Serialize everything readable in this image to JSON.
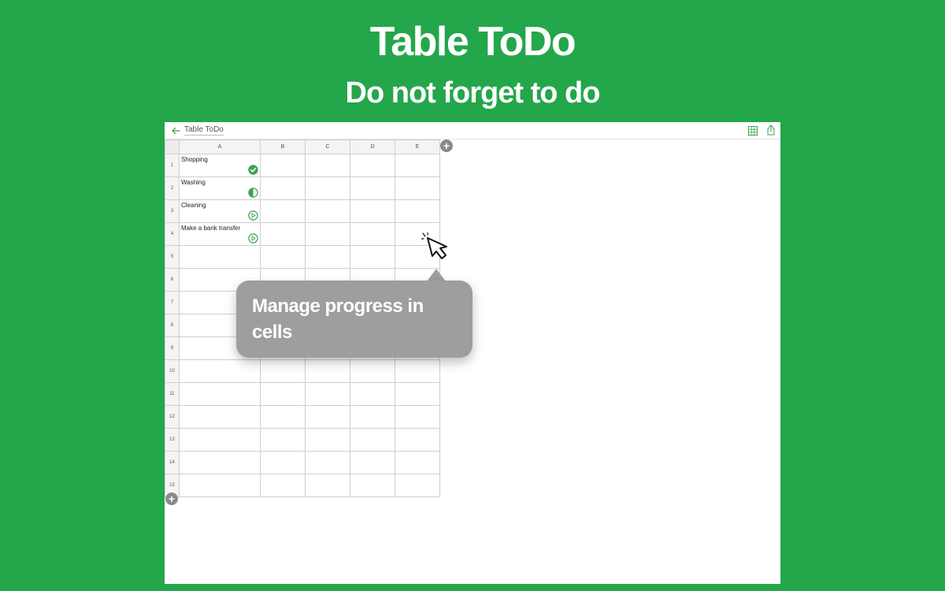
{
  "hero": {
    "title": "Table ToDo",
    "subtitle": "Do not forget to do"
  },
  "colors": {
    "background": "#24a64b",
    "accent": "#3aa64f",
    "tooltip": "#9e9e9e"
  },
  "app": {
    "title": "Table ToDo",
    "icons": [
      "back-arrow-icon",
      "grid-view-icon",
      "share-icon"
    ]
  },
  "sheet": {
    "columns": [
      "A",
      "B",
      "C",
      "D",
      "E"
    ],
    "rows": [
      {
        "num": "1",
        "task": "Shopping",
        "status": "done"
      },
      {
        "num": "2",
        "task": "Washing",
        "status": "half"
      },
      {
        "num": "3",
        "task": "Cleaning",
        "status": "play"
      },
      {
        "num": "4",
        "task": "Make a bank transfer",
        "status": "play"
      },
      {
        "num": "5",
        "task": "",
        "status": ""
      },
      {
        "num": "6",
        "task": "",
        "status": ""
      },
      {
        "num": "7",
        "task": "",
        "status": ""
      },
      {
        "num": "8",
        "task": "",
        "status": ""
      },
      {
        "num": "9",
        "task": "",
        "status": ""
      },
      {
        "num": "10",
        "task": "",
        "status": ""
      },
      {
        "num": "11",
        "task": "",
        "status": ""
      },
      {
        "num": "12",
        "task": "",
        "status": ""
      },
      {
        "num": "13",
        "task": "",
        "status": ""
      },
      {
        "num": "14",
        "task": "",
        "status": ""
      },
      {
        "num": "15",
        "task": "",
        "status": ""
      }
    ],
    "add_symbol": "+"
  },
  "tooltip": {
    "text": "Manage progress in cells"
  }
}
